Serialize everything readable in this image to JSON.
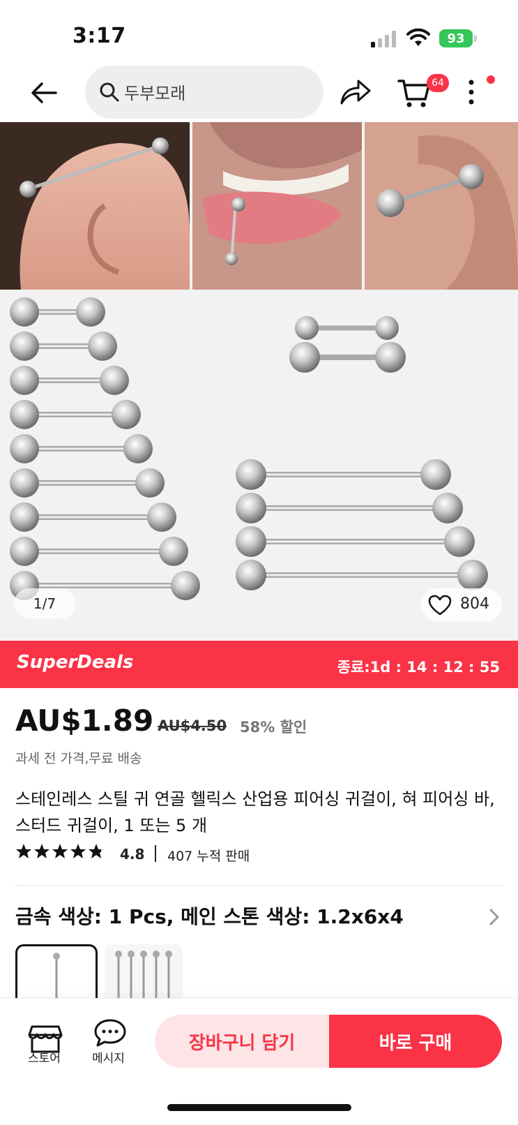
{
  "status": {
    "time": "3:17",
    "battery": "93"
  },
  "nav": {
    "search_placeholder": "두부모래",
    "cart_count": "64"
  },
  "gallery": {
    "counter": "1/7",
    "wishlist_count": "804"
  },
  "deals": {
    "title": "SuperDeals",
    "timer": "종료:1d : 14 : 12 : 55"
  },
  "product": {
    "price": "AU$1.89",
    "original_price": "AU$4.50",
    "discount": "58% 할인",
    "tax_note": "과세 전 가격,무료 배송",
    "title": "스테인레스 스틸 귀 연골 헬릭스 산업용 피어싱 귀걸이, 혀 피어싱 바, 스터드 귀걸이, 1 또는 5 개",
    "rating": "4.8",
    "rating_stars": 4.8,
    "sold": "407 누적 판매",
    "variant": "금속 색상: 1 Pcs, 메인 스톤 색상: 1.2x6x4"
  },
  "bottom": {
    "store_label": "스토어",
    "message_label": "메시지",
    "add_to_cart": "장바구니 담기",
    "buy_now": "바로 구매"
  },
  "colors": {
    "accent": "#fa3347",
    "accent_light": "#fde4e6"
  }
}
